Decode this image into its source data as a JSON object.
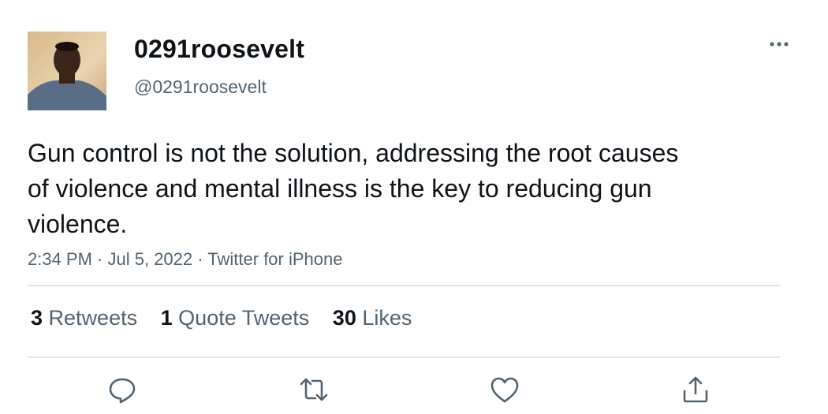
{
  "user": {
    "display_name": "0291roosevelt",
    "handle": "@0291roosevelt"
  },
  "tweet": {
    "text": "Gun control is not the solution, addressing the root causes of violence and mental illness is the key to reducing gun violence.",
    "time": "2:34 PM",
    "date": "Jul 5, 2022",
    "source": "Twitter for iPhone",
    "separator": " · "
  },
  "stats": {
    "retweets": {
      "count": "3",
      "label": "Retweets"
    },
    "quote_tweets": {
      "count": "1",
      "label": "Quote Tweets"
    },
    "likes": {
      "count": "30",
      "label": "Likes"
    }
  },
  "actions": {
    "reply_icon": "reply-icon",
    "retweet_icon": "retweet-icon",
    "like_icon": "heart-icon",
    "share_icon": "share-icon"
  },
  "colors": {
    "text_primary": "#0f1419",
    "text_secondary": "#536471",
    "divider": "#e1e4e6",
    "icon": "#536471"
  }
}
